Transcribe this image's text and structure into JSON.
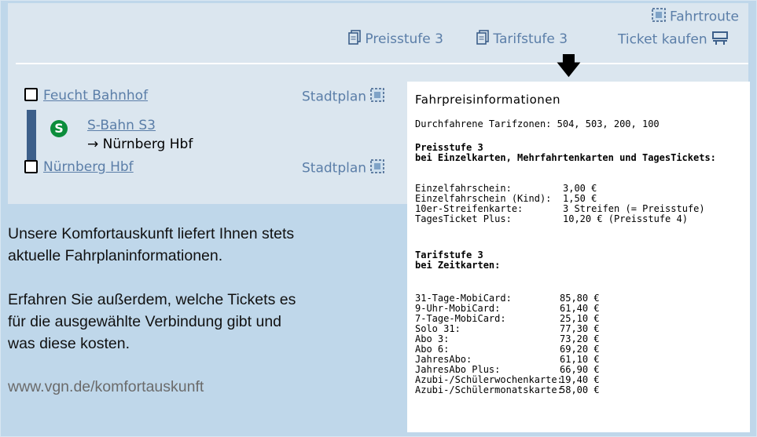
{
  "header": {
    "fahrtroute": "Fahrtroute",
    "preisstufe": "Preisstufe 3",
    "tarifstufe": "Tarifstufe 3",
    "ticket_kaufen": "Ticket kaufen"
  },
  "route": {
    "start_stop": "Feucht Bahnhof",
    "line": "S-Bahn S3",
    "logo_letter": "S",
    "direction": "→ Nürnberg Hbf",
    "end_stop": "Nürnberg Hbf",
    "stadtplan": "Stadtplan"
  },
  "info": {
    "p1_line1": "Unsere Komfortauskunft liefert Ihnen stets",
    "p1_line2": "aktuelle Fahrplaninformationen.",
    "p2_line1": "Erfahren Sie außerdem, welche Tickets es",
    "p2_line2": "für die ausgewählte Verbindung gibt und",
    "p2_line3": "was diese kosten.",
    "url": "www.vgn.de/komfortauskunft"
  },
  "popup": {
    "title": "Fahrpreisinformationen",
    "zones": "Durchfahrene Tarifzonen: 504, 503, 200, 100",
    "preisstufe_heading": "Preisstufe 3",
    "preisstufe_sub": "bei Einzelkarten, Mehrfahrtenkarten und TagesTickets:",
    "einzel": [
      {
        "name": "Einzelfahrschein:",
        "value": "3,00 €"
      },
      {
        "name": "Einzelfahrschein (Kind):",
        "value": "1,50 €"
      },
      {
        "name": "10er-Streifenkarte:",
        "value": "3 Streifen (= Preisstufe)"
      },
      {
        "name": "TagesTicket Plus:",
        "value": "10,20 € (Preisstufe 4)"
      }
    ],
    "tarifstufe_heading": "Tarifstufe 3",
    "tarifstufe_sub": "bei Zeitkarten:",
    "zeit": [
      {
        "name": "31-Tage-MobiCard:",
        "value": "85,80 €"
      },
      {
        "name": "9-Uhr-MobiCard:",
        "value": "61,40 €"
      },
      {
        "name": "7-Tage-MobiCard:",
        "value": "25,10 €"
      },
      {
        "name": "Solo 31:",
        "value": "77,30 €"
      },
      {
        "name": "Abo 3:",
        "value": "73,20 €"
      },
      {
        "name": "Abo 6:",
        "value": "69,20 €"
      },
      {
        "name": "JahresAbo:",
        "value": "61,10 €"
      },
      {
        "name": "JahresAbo Plus:",
        "value": "66,90 €"
      },
      {
        "name": "Azubi-/Schülerwochenkarte:",
        "value": "19,40 €"
      },
      {
        "name": "Azubi-/Schülermonatskarte:",
        "value": "58,00 €"
      }
    ]
  },
  "colors": {
    "link": "#5b7ea8",
    "route_bar": "#3c5f8a",
    "sbahn": "#0b8d3b",
    "background": "#bfd7ea",
    "panel": "#dbe6ef"
  },
  "icons": [
    "map-icon",
    "document-icon",
    "shopping-cart-icon",
    "down-arrow-icon",
    "s-bahn-logo-icon"
  ]
}
